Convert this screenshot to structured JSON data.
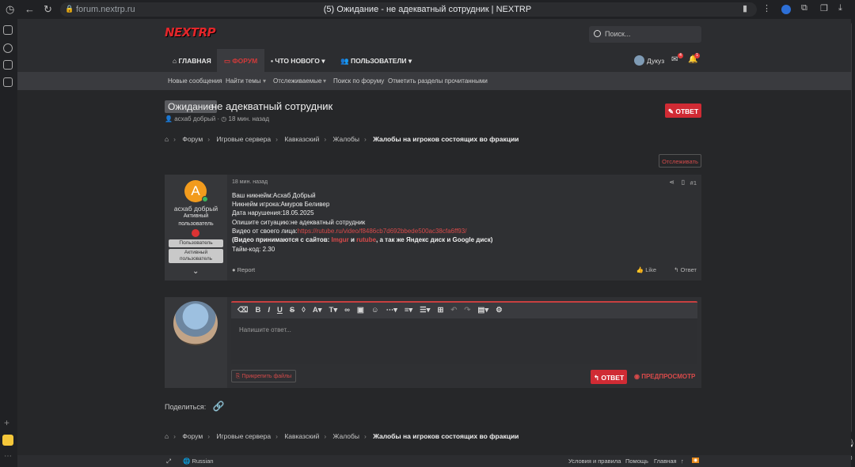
{
  "browser": {
    "url": "forum.nextrp.ru",
    "tab_title": "(5) Ожидание - не адекватный сотрудник | NEXTRP"
  },
  "site": {
    "logo": "NEXTRP",
    "search_placeholder": "Поиск...",
    "nav": [
      "ГЛАВНАЯ",
      "ФОРУМ",
      "ЧТО НОВОГО",
      "ПОЛЬЗОВАТЕЛИ"
    ],
    "user_name": "Дукуз",
    "inbox_count": "4",
    "alerts_count": "1",
    "subnav": [
      "Новые сообщения",
      "Найти темы",
      "Отслеживаемые",
      "Поиск по форуму",
      "Отметить разделы прочитанными"
    ]
  },
  "thread": {
    "prefix": "Ожидание",
    "title": "не адекватный сотрудник",
    "author": "асхаб добрый",
    "time": "18 мин. назад",
    "reply_button": "ОТВЕТ",
    "follow_button": "Отслеживать"
  },
  "breadcrumbs": [
    "Форум",
    "Игровые сервера",
    "Кавказский",
    "Жалобы",
    "Жалобы на игроков состоящих во фракции"
  ],
  "post": {
    "user": "асхаб добрый",
    "user_title_1": "Активный",
    "user_title_2": "пользователь",
    "role_1": "Пользователь",
    "role_2_line1": "Активный",
    "role_2_line2": "пользователь",
    "avatar_letter": "A",
    "time": "18 мин. назад",
    "number": "#1",
    "lines": [
      "Ваш никнейм:Асхаб Добрый",
      "Никнейм игрока:Амуров Беливер",
      "Дата нарушения:18.05.2025",
      "Опишите ситуацию:не адекватный сотрудник"
    ],
    "video_label": "Видео от своего лица:",
    "video_link": "https://rutube.ru/video/f8486cb7d692bbede500ac38cfa6ff93/",
    "note_1": "(Видео принимаются с сайтов: ",
    "note_imgur": "Imgur",
    "note_and": " и ",
    "note_rutube": "rutube",
    "note_2": ", а так же Яндекс диск и Google диск)",
    "timecode": "Тайм-код: 2.30",
    "report": "Report",
    "like": "Like",
    "answer": "Ответ"
  },
  "reply_form": {
    "placeholder": "Напишите ответ...",
    "attach": "Прикрепить файлы",
    "submit": "ОТВЕТ",
    "preview": "ПРЕДПРОСМОТР"
  },
  "share_label": "Поделиться:",
  "footer": {
    "language": "Russian",
    "links": [
      "Условия и правила",
      "Помощь",
      "Главная"
    ]
  }
}
